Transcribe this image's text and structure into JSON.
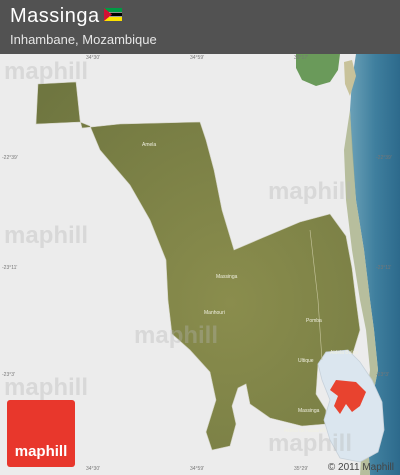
{
  "header": {
    "title": "Massinga",
    "subtitle": "Inhambane, Mozambique"
  },
  "logo": {
    "text": "maphill"
  },
  "copyright": "© 2011 Maphill",
  "watermarks": [
    "maphill",
    "maphill",
    "maphill",
    "maphill",
    "maphill",
    "maphill"
  ],
  "grid_labels": {
    "top": [
      "34°30'",
      "34°59'",
      "35°17'"
    ],
    "bottom": [
      "34°30'",
      "34°59'",
      "35°29'"
    ],
    "left": [
      "-22°39'",
      "-23°11'",
      "-23°3'"
    ],
    "right": [
      "-22°39'",
      "-23°11'",
      "-23°3'"
    ]
  },
  "places": [
    "Amela",
    "Massinga",
    "Manhouri",
    "Pomba",
    "Aldeia Bulao",
    "Ultique",
    "Massinga",
    "Aldeia de Nasareth"
  ],
  "colors": {
    "header_bg": "#3c3c3c",
    "logo_bg": "#e8372c",
    "region_fill": "#7f8547",
    "sea": "#3f7f9e",
    "highlight": "#e8432f"
  },
  "flag": {
    "colors": [
      "#009a44",
      "#000000",
      "#fce100",
      "#d21034",
      "#ffffff"
    ]
  }
}
